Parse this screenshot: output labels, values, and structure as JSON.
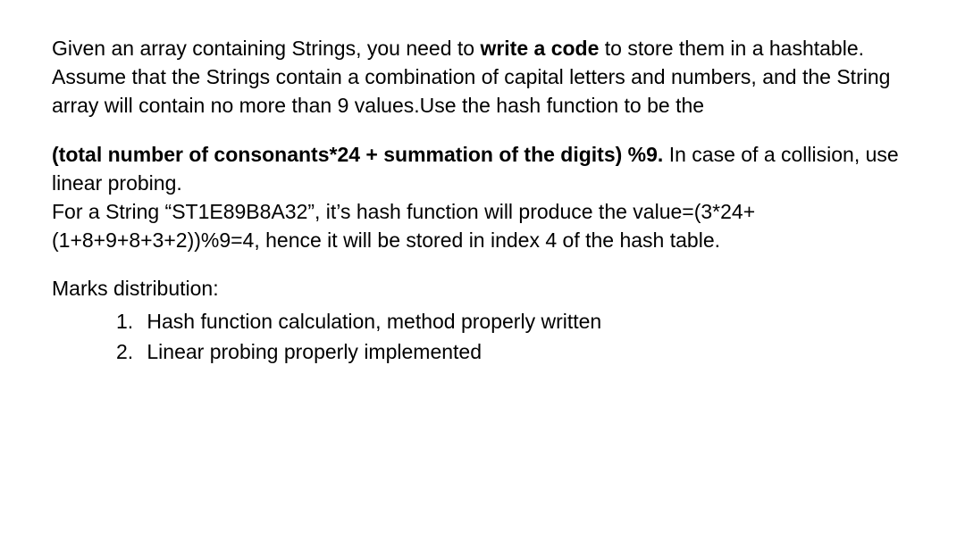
{
  "paragraph1": {
    "prefix": " Given an array containing Strings, you need to ",
    "bold": "write a code",
    "suffix": " to store them in a hashtable. Assume that the Strings contain a combination of capital letters and numbers, and the String array will contain no more than 9 values.Use the hash function to be the"
  },
  "paragraph2": {
    "bold": " (total number of consonants*24 + summation of the digits) %9.",
    "line1_suffix": " In case of a collision, use linear probing.",
    "line2": "For a String “ST1E89B8A32”, it’s hash function will produce the value=(3*24+(1+8+9+8+3+2))%9=4, hence it will be stored in index 4 of the hash table."
  },
  "marks": {
    "header": "Marks distribution:",
    "items": [
      {
        "number": "1.",
        "text": "Hash function calculation, method properly written"
      },
      {
        "number": "2.",
        "text": "Linear probing properly implemented"
      }
    ]
  }
}
